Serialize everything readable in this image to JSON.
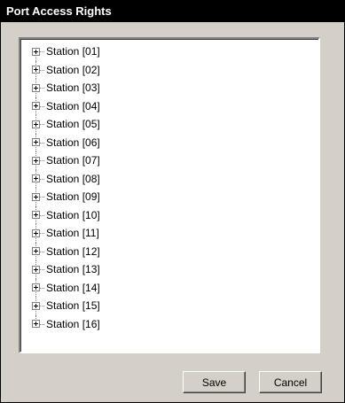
{
  "window": {
    "title": "Port Access Rights"
  },
  "tree": {
    "items": [
      {
        "label": "Station [01]",
        "icon": "expand-plus-icon"
      },
      {
        "label": "Station [02]",
        "icon": "expand-plus-icon"
      },
      {
        "label": "Station [03]",
        "icon": "expand-plus-icon"
      },
      {
        "label": "Station [04]",
        "icon": "expand-plus-icon"
      },
      {
        "label": "Station [05]",
        "icon": "expand-plus-icon"
      },
      {
        "label": "Station [06]",
        "icon": "expand-plus-icon"
      },
      {
        "label": "Station [07]",
        "icon": "expand-plus-icon"
      },
      {
        "label": "Station [08]",
        "icon": "expand-plus-icon"
      },
      {
        "label": "Station [09]",
        "icon": "expand-plus-icon"
      },
      {
        "label": "Station [10]",
        "icon": "expand-plus-icon"
      },
      {
        "label": "Station [11]",
        "icon": "expand-plus-icon"
      },
      {
        "label": "Station [12]",
        "icon": "expand-plus-icon"
      },
      {
        "label": "Station [13]",
        "icon": "expand-plus-icon"
      },
      {
        "label": "Station [14]",
        "icon": "expand-plus-icon"
      },
      {
        "label": "Station [15]",
        "icon": "expand-plus-icon"
      },
      {
        "label": "Station [16]",
        "icon": "expand-plus-icon"
      }
    ]
  },
  "buttons": {
    "save_label": "Save",
    "cancel_label": "Cancel"
  },
  "colors": {
    "title_bar": "#000000",
    "title_text": "#ffffff",
    "dialog_face": "#d4d0c8",
    "tree_background": "#ffffff"
  }
}
